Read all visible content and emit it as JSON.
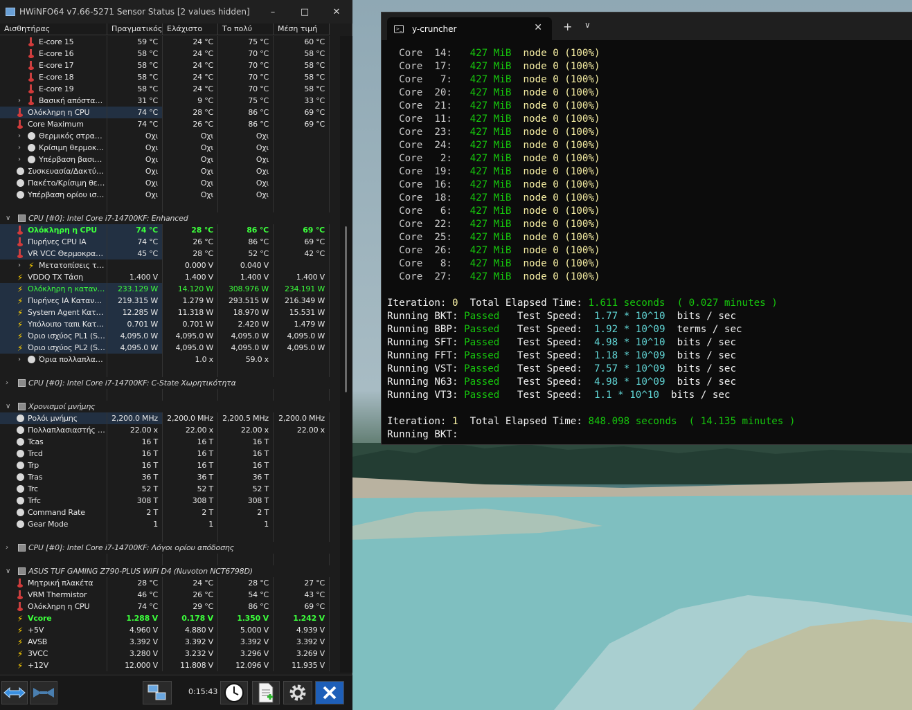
{
  "hwinfo": {
    "title": "HWiNFO64 v7.66-5271 Sensor Status [2 values hidden]",
    "columns": [
      "Αισθητήρας",
      "Πραγματικός",
      "Ελάχιστο",
      "Το πολύ",
      "Μέση τιμή"
    ],
    "rows": [
      {
        "kind": "sensor",
        "indent": 2,
        "icon": "thermometer-icon",
        "name": "E-core 15",
        "vals": [
          "59 °C",
          "24 °C",
          "75 °C",
          "60 °C"
        ]
      },
      {
        "kind": "sensor",
        "indent": 2,
        "icon": "thermometer-icon",
        "name": "E-core 16",
        "vals": [
          "58 °C",
          "24 °C",
          "70 °C",
          "58 °C"
        ]
      },
      {
        "kind": "sensor",
        "indent": 2,
        "icon": "thermometer-icon",
        "name": "E-core 17",
        "vals": [
          "58 °C",
          "24 °C",
          "70 °C",
          "58 °C"
        ]
      },
      {
        "kind": "sensor",
        "indent": 2,
        "icon": "thermometer-icon",
        "name": "E-core 18",
        "vals": [
          "58 °C",
          "24 °C",
          "70 °C",
          "58 °C"
        ]
      },
      {
        "kind": "sensor",
        "indent": 2,
        "icon": "thermometer-icon",
        "name": "E-core 19",
        "vals": [
          "58 °C",
          "24 °C",
          "70 °C",
          "58 °C"
        ]
      },
      {
        "kind": "sensor",
        "indent": 2,
        "expand": true,
        "icon": "thermometer-icon",
        "name": "Βασική απόσταση...",
        "vals": [
          "31 °C",
          "9 °C",
          "75 °C",
          "33 °C"
        ]
      },
      {
        "kind": "sensor",
        "indent": 1,
        "sel": true,
        "icon": "thermometer-icon",
        "name": "Ολόκληρη η CPU",
        "vals": [
          "74 °C",
          "28 °C",
          "86 °C",
          "69 °C"
        ]
      },
      {
        "kind": "sensor",
        "indent": 1,
        "icon": "thermometer-icon",
        "name": "Core Maximum",
        "vals": [
          "74 °C",
          "26 °C",
          "86 °C",
          "69 °C"
        ]
      },
      {
        "kind": "sensor",
        "indent": 2,
        "expand": true,
        "icon": "circle-icon",
        "name": "Θερμικός στραγγ...",
        "vals": [
          "Οχι",
          "Οχι",
          "Οχι",
          ""
        ]
      },
      {
        "kind": "sensor",
        "indent": 2,
        "expand": true,
        "icon": "circle-icon",
        "name": "Κρίσιμη θερμοκρ...",
        "vals": [
          "Οχι",
          "Οχι",
          "Οχι",
          ""
        ]
      },
      {
        "kind": "sensor",
        "indent": 2,
        "expand": true,
        "icon": "circle-icon",
        "name": "Υπέρβαση βασικο...",
        "vals": [
          "Οχι",
          "Οχι",
          "Οχι",
          ""
        ]
      },
      {
        "kind": "sensor",
        "indent": 1,
        "icon": "circle-icon",
        "name": "Συσκευασία/Δακτύλι...",
        "vals": [
          "Οχι",
          "Οχι",
          "Οχι",
          ""
        ]
      },
      {
        "kind": "sensor",
        "indent": 1,
        "icon": "circle-icon",
        "name": "Πακέτο/Κρίσιμη θερμ...",
        "vals": [
          "Οχι",
          "Οχι",
          "Οχι",
          ""
        ]
      },
      {
        "kind": "sensor",
        "indent": 1,
        "icon": "circle-icon",
        "name": "Υπέρβαση ορίου ισχύ...",
        "vals": [
          "Οχι",
          "Οχι",
          "Οχι",
          ""
        ]
      },
      {
        "kind": "empty"
      },
      {
        "kind": "group",
        "expanded": true,
        "name": "CPU [#0]: Intel Core i7-14700KF: Enhanced"
      },
      {
        "kind": "sensor",
        "indent": 1,
        "style": "green",
        "sel": true,
        "icon": "thermometer-icon",
        "name": "Ολόκληρη η CPU",
        "vals": [
          "74 °C",
          "28 °C",
          "86 °C",
          "69 °C"
        ]
      },
      {
        "kind": "sensor",
        "indent": 1,
        "sel": true,
        "icon": "thermometer-icon",
        "name": "Πυρήνες CPU IA",
        "vals": [
          "74 °C",
          "26 °C",
          "86 °C",
          "69 °C"
        ]
      },
      {
        "kind": "sensor",
        "indent": 1,
        "sel": true,
        "icon": "thermometer-icon",
        "name": "VR VCC Θερμοκρασί...",
        "vals": [
          "45 °C",
          "28 °C",
          "52 °C",
          "42 °C"
        ]
      },
      {
        "kind": "sensor",
        "indent": 2,
        "expand": true,
        "icon": "bolt-icon",
        "name": "Μετατοπίσεις τάσης",
        "vals": [
          "",
          "0.000 V",
          "0.040 V",
          ""
        ]
      },
      {
        "kind": "sensor",
        "indent": 1,
        "icon": "bolt-icon",
        "name": "VDDQ TX Τάση",
        "vals": [
          "1.400 V",
          "1.400 V",
          "1.400 V",
          "1.400 V"
        ]
      },
      {
        "kind": "sensor",
        "indent": 1,
        "style": "greenlite",
        "sel": true,
        "icon": "bolt-icon",
        "name": "Ολόκληρη η κατανά...",
        "vals": [
          "233.129 W",
          "14.120 W",
          "308.976 W",
          "234.191 W"
        ]
      },
      {
        "kind": "sensor",
        "indent": 1,
        "sel": true,
        "icon": "bolt-icon",
        "name": "Πυρήνες IA Κατανάλ...",
        "vals": [
          "219.315 W",
          "1.279 W",
          "293.515 W",
          "216.349 W"
        ]
      },
      {
        "kind": "sensor",
        "indent": 1,
        "sel": true,
        "icon": "bolt-icon",
        "name": "System Agent Καταν...",
        "vals": [
          "12.285 W",
          "11.318 W",
          "18.970 W",
          "15.531 W"
        ]
      },
      {
        "kind": "sensor",
        "indent": 1,
        "sel": true,
        "icon": "bolt-icon",
        "name": "Υπόλοιπο ταπι Καταν...",
        "vals": [
          "0.701 W",
          "0.701 W",
          "2.420 W",
          "1.479 W"
        ]
      },
      {
        "kind": "sensor",
        "indent": 1,
        "sel": true,
        "icon": "bolt-icon",
        "name": "Όριο ισχύος PL1 (St...",
        "vals": [
          "4,095.0 W",
          "4,095.0 W",
          "4,095.0 W",
          "4,095.0 W"
        ]
      },
      {
        "kind": "sensor",
        "indent": 1,
        "sel": true,
        "icon": "bolt-icon",
        "name": "Όριο ισχύος PL2 (St...",
        "vals": [
          "4,095.0 W",
          "4,095.0 W",
          "4,095.0 W",
          "4,095.0 W"
        ]
      },
      {
        "kind": "sensor",
        "indent": 2,
        "expand": true,
        "icon": "circle-icon",
        "name": "Όρια πολλαπλασι...",
        "vals": [
          "",
          "1.0 x",
          "59.0 x",
          ""
        ]
      },
      {
        "kind": "empty"
      },
      {
        "kind": "group",
        "expanded": false,
        "name": "CPU [#0]: Intel Core i7-14700KF: C-State Χωρητικότητα"
      },
      {
        "kind": "empty"
      },
      {
        "kind": "group",
        "expanded": true,
        "name": "Χρονισμοί μνήμης"
      },
      {
        "kind": "sensor",
        "indent": 1,
        "sel": true,
        "icon": "circle-icon",
        "name": "Ρολόι μνήμης",
        "vals": [
          "2,200.0 MHz",
          "2,200.0 MHz",
          "2,200.5 MHz",
          "2,200.0 MHz"
        ]
      },
      {
        "kind": "sensor",
        "indent": 1,
        "icon": "circle-icon",
        "name": "Πολλαπλασιαστής ρ...",
        "vals": [
          "22.00 x",
          "22.00 x",
          "22.00 x",
          "22.00 x"
        ]
      },
      {
        "kind": "sensor",
        "indent": 1,
        "icon": "circle-icon",
        "name": "Tcas",
        "vals": [
          "16 T",
          "16 T",
          "16 T",
          ""
        ]
      },
      {
        "kind": "sensor",
        "indent": 1,
        "icon": "circle-icon",
        "name": "Trcd",
        "vals": [
          "16 T",
          "16 T",
          "16 T",
          ""
        ]
      },
      {
        "kind": "sensor",
        "indent": 1,
        "icon": "circle-icon",
        "name": "Trp",
        "vals": [
          "16 T",
          "16 T",
          "16 T",
          ""
        ]
      },
      {
        "kind": "sensor",
        "indent": 1,
        "icon": "circle-icon",
        "name": "Tras",
        "vals": [
          "36 T",
          "36 T",
          "36 T",
          ""
        ]
      },
      {
        "kind": "sensor",
        "indent": 1,
        "icon": "circle-icon",
        "name": "Trc",
        "vals": [
          "52 T",
          "52 T",
          "52 T",
          ""
        ]
      },
      {
        "kind": "sensor",
        "indent": 1,
        "icon": "circle-icon",
        "name": "Trfc",
        "vals": [
          "308 T",
          "308 T",
          "308 T",
          ""
        ]
      },
      {
        "kind": "sensor",
        "indent": 1,
        "icon": "circle-icon",
        "name": "Command Rate",
        "vals": [
          "2 T",
          "2 T",
          "2 T",
          ""
        ]
      },
      {
        "kind": "sensor",
        "indent": 1,
        "icon": "circle-icon",
        "name": "Gear Mode",
        "vals": [
          "1",
          "1",
          "1",
          ""
        ]
      },
      {
        "kind": "empty"
      },
      {
        "kind": "group",
        "expanded": false,
        "name": "CPU [#0]: Intel Core i7-14700KF: Λόγοι ορίου απόδοσης"
      },
      {
        "kind": "empty"
      },
      {
        "kind": "group",
        "expanded": true,
        "name": "ASUS TUF GAMING Z790-PLUS WIFI D4 (Nuvoton NCT6798D)"
      },
      {
        "kind": "sensor",
        "indent": 1,
        "icon": "thermometer-icon",
        "name": "Μητρική πλακέτα",
        "vals": [
          "28 °C",
          "24 °C",
          "28 °C",
          "27 °C"
        ]
      },
      {
        "kind": "sensor",
        "indent": 1,
        "icon": "thermometer-icon",
        "name": "VRM Thermistor",
        "vals": [
          "46 °C",
          "26 °C",
          "54 °C",
          "43 °C"
        ]
      },
      {
        "kind": "sensor",
        "indent": 1,
        "icon": "thermometer-icon",
        "name": "Ολόκληρη η CPU",
        "vals": [
          "74 °C",
          "29 °C",
          "86 °C",
          "69 °C"
        ]
      },
      {
        "kind": "sensor",
        "indent": 1,
        "style": "green",
        "icon": "bolt-icon",
        "name": "Vcore",
        "vals": [
          "1.288 V",
          "0.178 V",
          "1.350 V",
          "1.242 V"
        ]
      },
      {
        "kind": "sensor",
        "indent": 1,
        "icon": "bolt-icon",
        "name": "+5V",
        "vals": [
          "4.960 V",
          "4.880 V",
          "5.000 V",
          "4.939 V"
        ]
      },
      {
        "kind": "sensor",
        "indent": 1,
        "icon": "bolt-icon",
        "name": "AVSB",
        "vals": [
          "3.392 V",
          "3.392 V",
          "3.392 V",
          "3.392 V"
        ]
      },
      {
        "kind": "sensor",
        "indent": 1,
        "icon": "bolt-icon",
        "name": "3VCC",
        "vals": [
          "3.280 V",
          "3.232 V",
          "3.296 V",
          "3.269 V"
        ]
      },
      {
        "kind": "sensor",
        "indent": 1,
        "icon": "bolt-icon",
        "name": "+12V",
        "vals": [
          "12.000 V",
          "11.808 V",
          "12.096 V",
          "11.935 V"
        ]
      }
    ],
    "status": {
      "timer": "0:15:43"
    }
  },
  "terminal": {
    "tab_title": "y-cruncher",
    "core_lines": [
      {
        "core": "14",
        "mem": "427 MiB",
        "node": "node 0 (100%)"
      },
      {
        "core": "17",
        "mem": "427 MiB",
        "node": "node 0 (100%)"
      },
      {
        "core": "7",
        "mem": "427 MiB",
        "node": "node 0 (100%)"
      },
      {
        "core": "20",
        "mem": "427 MiB",
        "node": "node 0 (100%)"
      },
      {
        "core": "21",
        "mem": "427 MiB",
        "node": "node 0 (100%)"
      },
      {
        "core": "11",
        "mem": "427 MiB",
        "node": "node 0 (100%)"
      },
      {
        "core": "23",
        "mem": "427 MiB",
        "node": "node 0 (100%)"
      },
      {
        "core": "24",
        "mem": "427 MiB",
        "node": "node 0 (100%)"
      },
      {
        "core": "2",
        "mem": "427 MiB",
        "node": "node 0 (100%)"
      },
      {
        "core": "19",
        "mem": "427 MiB",
        "node": "node 0 (100%)"
      },
      {
        "core": "16",
        "mem": "427 MiB",
        "node": "node 0 (100%)"
      },
      {
        "core": "18",
        "mem": "427 MiB",
        "node": "node 0 (100%)"
      },
      {
        "core": "6",
        "mem": "427 MiB",
        "node": "node 0 (100%)"
      },
      {
        "core": "22",
        "mem": "427 MiB",
        "node": "node 0 (100%)"
      },
      {
        "core": "25",
        "mem": "427 MiB",
        "node": "node 0 (100%)"
      },
      {
        "core": "26",
        "mem": "427 MiB",
        "node": "node 0 (100%)"
      },
      {
        "core": "8",
        "mem": "427 MiB",
        "node": "node 0 (100%)"
      },
      {
        "core": "27",
        "mem": "427 MiB",
        "node": "node 0 (100%)"
      }
    ],
    "iteration0": {
      "num": "0",
      "time": "1.611 seconds",
      "minutes": "( 0.027 minutes )"
    },
    "tests": [
      {
        "name": "BKT",
        "status": "Passed",
        "speed": "1.77 * 10^10",
        "unit": "bits / sec"
      },
      {
        "name": "BBP",
        "status": "Passed",
        "speed": "1.92 * 10^09",
        "unit": "terms / sec"
      },
      {
        "name": "SFT",
        "status": "Passed",
        "speed": "4.98 * 10^10",
        "unit": "bits / sec"
      },
      {
        "name": "FFT",
        "status": "Passed",
        "speed": "1.18 * 10^09",
        "unit": "bits / sec"
      },
      {
        "name": "VST",
        "status": "Passed",
        "speed": "7.57 * 10^09",
        "unit": "bits / sec"
      },
      {
        "name": "N63",
        "status": "Passed",
        "speed": "4.98 * 10^09",
        "unit": "bits / sec"
      },
      {
        "name": "VT3",
        "status": "Passed",
        "speed": "1.1 * 10^10",
        "unit": "bits / sec"
      }
    ],
    "iteration1": {
      "num": "1",
      "time": "848.098 seconds",
      "minutes": "( 14.135 minutes )"
    },
    "last_line": "Running BKT:"
  }
}
